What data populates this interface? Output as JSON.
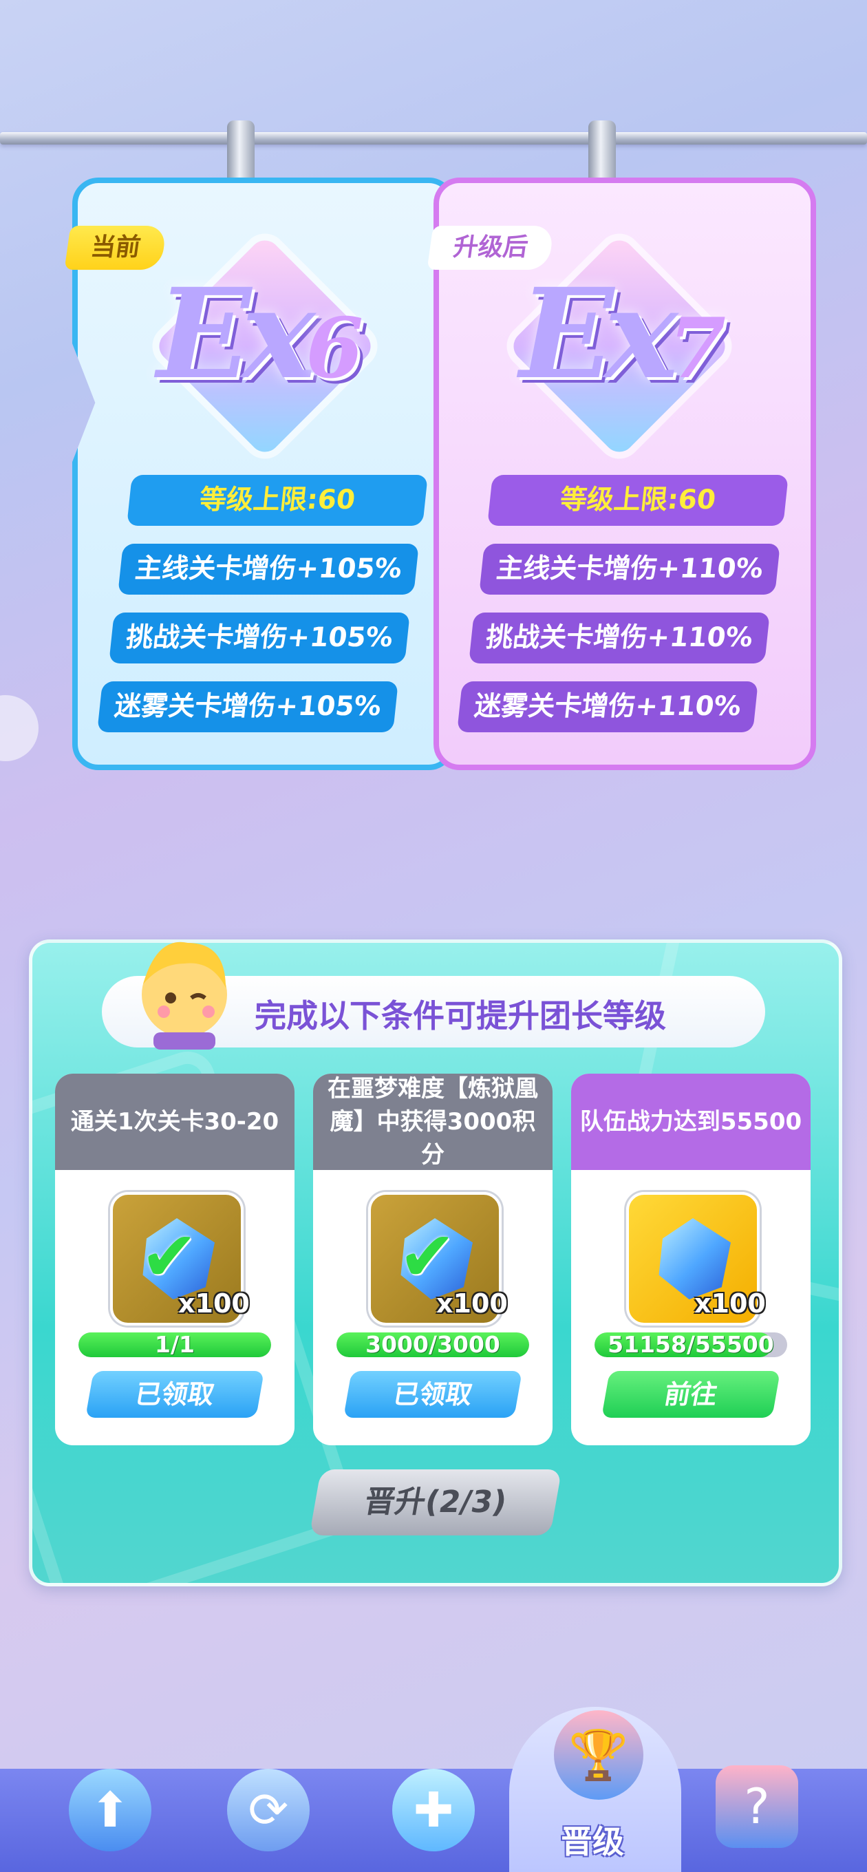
{
  "current_card": {
    "tag": "当前",
    "rank_prefix": "Ex",
    "rank_num": "6",
    "level_cap": "等级上限:60",
    "bonuses": [
      "主线关卡增伤+105%",
      "挑战关卡增伤+105%",
      "迷雾关卡增伤+105%"
    ]
  },
  "next_card": {
    "tag": "升级后",
    "rank_prefix": "Ex",
    "rank_num": "7",
    "level_cap": "等级上限:60",
    "bonuses": [
      "主线关卡增伤+110%",
      "挑战关卡增伤+110%",
      "迷雾关卡增伤+110%"
    ]
  },
  "requirements": {
    "title": "完成以下条件可提升团长等级",
    "tasks": [
      {
        "title": "通关1次关卡30-20",
        "reward_qty": "x100",
        "progress_text": "1/1",
        "progress": 1.0,
        "button": "已领取",
        "claimed": true
      },
      {
        "title": "在噩梦难度【炼狱凰魔】中获得3000积分",
        "reward_qty": "x100",
        "progress_text": "3000/3000",
        "progress": 1.0,
        "button": "已领取",
        "claimed": true
      },
      {
        "title": "队伍战力达到55500",
        "reward_qty": "x100",
        "progress_text": "51158/55500",
        "progress": 0.92,
        "button": "前往",
        "claimed": false
      }
    ],
    "promote_button": "晋升(2/3)"
  },
  "bottom_nav": {
    "active_label": "晋级",
    "icons": [
      "arrow-up-icon",
      "spin-icon",
      "gamepad-icon",
      "trophy-icon",
      "slot-machine-icon"
    ]
  },
  "colors": {
    "current_border": "#39b6f2",
    "next_border": "#d57bf0",
    "panel": "#3ad7cf",
    "progress": "#1fc93a"
  }
}
